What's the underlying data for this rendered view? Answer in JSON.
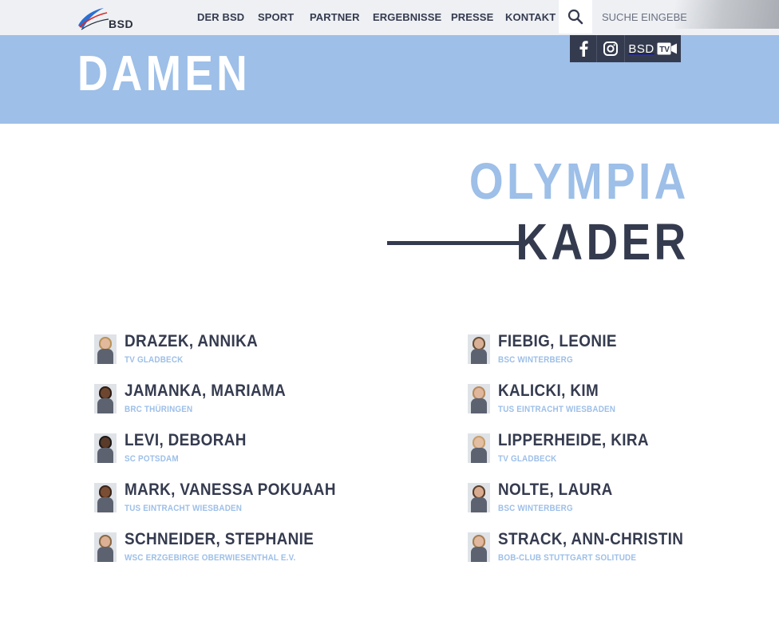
{
  "header": {
    "logo_text": "BSD",
    "nav": [
      {
        "label": "DER BSD"
      },
      {
        "label": "SPORT"
      },
      {
        "label": "PARTNER"
      },
      {
        "label": "ERGEBNISSE"
      },
      {
        "label": "PRESSE"
      },
      {
        "label": "KONTAKT"
      }
    ],
    "search": {
      "placeholder": "SUCHE EINGEBEN",
      "icon": "search-icon"
    },
    "social": [
      {
        "name": "facebook",
        "icon": "facebook-icon"
      },
      {
        "name": "instagram",
        "icon": "instagram-icon"
      },
      {
        "name": "bsd-tv",
        "label": "BSD",
        "icon": "tv-camera-icon"
      }
    ]
  },
  "hero": {
    "title": "DAMEN"
  },
  "section": {
    "title_line1": "OLYMPIA",
    "title_line2": "KADER"
  },
  "athletes": [
    {
      "name": "DRAZEK, ANNIKA",
      "club": "TV GLADBECK"
    },
    {
      "name": "JAMANKA, MARIAMA",
      "club": "BRC THÜRINGEN"
    },
    {
      "name": "LEVI, DEBORAH",
      "club": "SC POTSDAM"
    },
    {
      "name": "MARK, VANESSA POKUAAH",
      "club": "TUS EINTRACHT WIESBADEN"
    },
    {
      "name": "SCHNEIDER, STEPHANIE",
      "club": "WSC ERZGEBIRGE OBERWIESENTHAL E.V."
    },
    {
      "name": "FIEBIG, LEONIE",
      "club": "BSC WINTERBERG"
    },
    {
      "name": "KALICKI, KIM",
      "club": "TUS EINTRACHT WIESBADEN"
    },
    {
      "name": "LIPPERHEIDE, KIRA",
      "club": "TV GLADBECK"
    },
    {
      "name": "NOLTE, LAURA",
      "club": "BSC WINTERBERG"
    },
    {
      "name": "STRACK, ANN-CHRISTIN",
      "club": "BOB-CLUB STUTTGART SOLITUDE"
    }
  ],
  "colors": {
    "accent": "#9dbfe8",
    "dark": "#353b4f",
    "topbar": "#eef0f4"
  }
}
